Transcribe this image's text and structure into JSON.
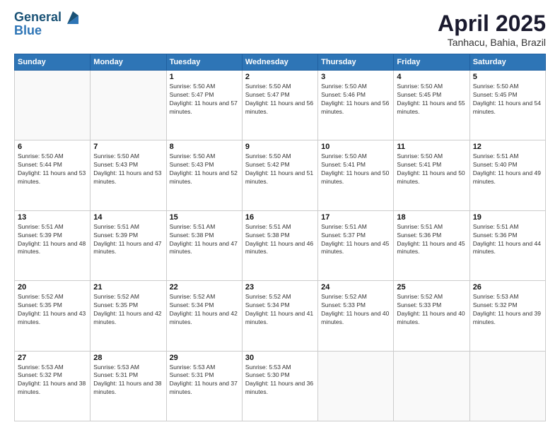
{
  "header": {
    "logo_line1": "General",
    "logo_line2": "Blue",
    "month": "April 2025",
    "location": "Tanhacu, Bahia, Brazil"
  },
  "days_of_week": [
    "Sunday",
    "Monday",
    "Tuesday",
    "Wednesday",
    "Thursday",
    "Friday",
    "Saturday"
  ],
  "weeks": [
    [
      {
        "day": "",
        "info": ""
      },
      {
        "day": "",
        "info": ""
      },
      {
        "day": "1",
        "info": "Sunrise: 5:50 AM\nSunset: 5:47 PM\nDaylight: 11 hours and 57 minutes."
      },
      {
        "day": "2",
        "info": "Sunrise: 5:50 AM\nSunset: 5:47 PM\nDaylight: 11 hours and 56 minutes."
      },
      {
        "day": "3",
        "info": "Sunrise: 5:50 AM\nSunset: 5:46 PM\nDaylight: 11 hours and 56 minutes."
      },
      {
        "day": "4",
        "info": "Sunrise: 5:50 AM\nSunset: 5:45 PM\nDaylight: 11 hours and 55 minutes."
      },
      {
        "day": "5",
        "info": "Sunrise: 5:50 AM\nSunset: 5:45 PM\nDaylight: 11 hours and 54 minutes."
      }
    ],
    [
      {
        "day": "6",
        "info": "Sunrise: 5:50 AM\nSunset: 5:44 PM\nDaylight: 11 hours and 53 minutes."
      },
      {
        "day": "7",
        "info": "Sunrise: 5:50 AM\nSunset: 5:43 PM\nDaylight: 11 hours and 53 minutes."
      },
      {
        "day": "8",
        "info": "Sunrise: 5:50 AM\nSunset: 5:43 PM\nDaylight: 11 hours and 52 minutes."
      },
      {
        "day": "9",
        "info": "Sunrise: 5:50 AM\nSunset: 5:42 PM\nDaylight: 11 hours and 51 minutes."
      },
      {
        "day": "10",
        "info": "Sunrise: 5:50 AM\nSunset: 5:41 PM\nDaylight: 11 hours and 50 minutes."
      },
      {
        "day": "11",
        "info": "Sunrise: 5:50 AM\nSunset: 5:41 PM\nDaylight: 11 hours and 50 minutes."
      },
      {
        "day": "12",
        "info": "Sunrise: 5:51 AM\nSunset: 5:40 PM\nDaylight: 11 hours and 49 minutes."
      }
    ],
    [
      {
        "day": "13",
        "info": "Sunrise: 5:51 AM\nSunset: 5:39 PM\nDaylight: 11 hours and 48 minutes."
      },
      {
        "day": "14",
        "info": "Sunrise: 5:51 AM\nSunset: 5:39 PM\nDaylight: 11 hours and 47 minutes."
      },
      {
        "day": "15",
        "info": "Sunrise: 5:51 AM\nSunset: 5:38 PM\nDaylight: 11 hours and 47 minutes."
      },
      {
        "day": "16",
        "info": "Sunrise: 5:51 AM\nSunset: 5:38 PM\nDaylight: 11 hours and 46 minutes."
      },
      {
        "day": "17",
        "info": "Sunrise: 5:51 AM\nSunset: 5:37 PM\nDaylight: 11 hours and 45 minutes."
      },
      {
        "day": "18",
        "info": "Sunrise: 5:51 AM\nSunset: 5:36 PM\nDaylight: 11 hours and 45 minutes."
      },
      {
        "day": "19",
        "info": "Sunrise: 5:51 AM\nSunset: 5:36 PM\nDaylight: 11 hours and 44 minutes."
      }
    ],
    [
      {
        "day": "20",
        "info": "Sunrise: 5:52 AM\nSunset: 5:35 PM\nDaylight: 11 hours and 43 minutes."
      },
      {
        "day": "21",
        "info": "Sunrise: 5:52 AM\nSunset: 5:35 PM\nDaylight: 11 hours and 42 minutes."
      },
      {
        "day": "22",
        "info": "Sunrise: 5:52 AM\nSunset: 5:34 PM\nDaylight: 11 hours and 42 minutes."
      },
      {
        "day": "23",
        "info": "Sunrise: 5:52 AM\nSunset: 5:34 PM\nDaylight: 11 hours and 41 minutes."
      },
      {
        "day": "24",
        "info": "Sunrise: 5:52 AM\nSunset: 5:33 PM\nDaylight: 11 hours and 40 minutes."
      },
      {
        "day": "25",
        "info": "Sunrise: 5:52 AM\nSunset: 5:33 PM\nDaylight: 11 hours and 40 minutes."
      },
      {
        "day": "26",
        "info": "Sunrise: 5:53 AM\nSunset: 5:32 PM\nDaylight: 11 hours and 39 minutes."
      }
    ],
    [
      {
        "day": "27",
        "info": "Sunrise: 5:53 AM\nSunset: 5:32 PM\nDaylight: 11 hours and 38 minutes."
      },
      {
        "day": "28",
        "info": "Sunrise: 5:53 AM\nSunset: 5:31 PM\nDaylight: 11 hours and 38 minutes."
      },
      {
        "day": "29",
        "info": "Sunrise: 5:53 AM\nSunset: 5:31 PM\nDaylight: 11 hours and 37 minutes."
      },
      {
        "day": "30",
        "info": "Sunrise: 5:53 AM\nSunset: 5:30 PM\nDaylight: 11 hours and 36 minutes."
      },
      {
        "day": "",
        "info": ""
      },
      {
        "day": "",
        "info": ""
      },
      {
        "day": "",
        "info": ""
      }
    ]
  ]
}
